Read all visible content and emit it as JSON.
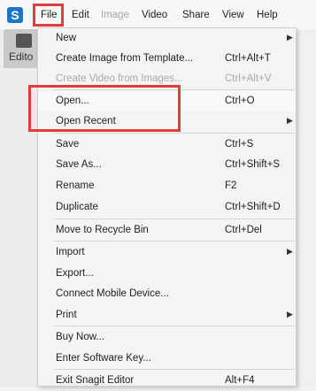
{
  "app": {
    "icon_letter": "S"
  },
  "menubar": {
    "items": [
      {
        "label": "File"
      },
      {
        "label": "Edit"
      },
      {
        "label": "Image"
      },
      {
        "label": "Video"
      },
      {
        "label": "Share"
      },
      {
        "label": "View"
      },
      {
        "label": "Help"
      }
    ]
  },
  "editor_tab": {
    "label": "Edito"
  },
  "file_menu": {
    "items": [
      {
        "label": "New",
        "shortcut": "",
        "submenu": true
      },
      {
        "label": "Create Image from Template...",
        "shortcut": "Ctrl+Alt+T"
      },
      {
        "label": "Create Video from Images...",
        "shortcut": "Ctrl+Alt+V",
        "disabled": true
      },
      {
        "label": "Open...",
        "shortcut": "Ctrl+O"
      },
      {
        "label": "Open Recent",
        "shortcut": "",
        "submenu": true
      },
      {
        "label": "Save",
        "shortcut": "Ctrl+S"
      },
      {
        "label": "Save As...",
        "shortcut": "Ctrl+Shift+S"
      },
      {
        "label": "Rename",
        "shortcut": "F2"
      },
      {
        "label": "Duplicate",
        "shortcut": "Ctrl+Shift+D"
      },
      {
        "label": "Move to Recycle Bin",
        "shortcut": "Ctrl+Del"
      },
      {
        "label": "Import",
        "shortcut": "",
        "submenu": true
      },
      {
        "label": "Export...",
        "shortcut": ""
      },
      {
        "label": "Connect Mobile Device...",
        "shortcut": ""
      },
      {
        "label": "Print",
        "shortcut": "",
        "submenu": true
      },
      {
        "label": "Buy Now...",
        "shortcut": ""
      },
      {
        "label": "Enter Software Key...",
        "shortcut": ""
      },
      {
        "label": "Exit Snagit Editor",
        "shortcut": "Alt+F4"
      }
    ]
  },
  "colors": {
    "highlight": "#e23b3b",
    "accent": "#1f76c7"
  }
}
